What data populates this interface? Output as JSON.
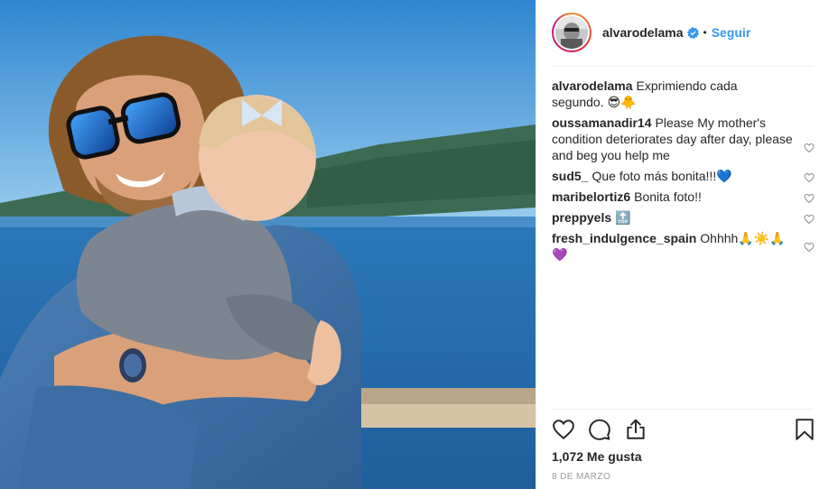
{
  "post": {
    "username": "alvarodelama",
    "follow_separator": "•",
    "follow_label": "Seguir",
    "likes": "1,072 Me gusta",
    "date": "8 DE MARZO"
  },
  "comments": [
    {
      "user": "alvarodelama",
      "text": "Exprimiendo cada segundo. 😎🐥",
      "has_like": false
    },
    {
      "user": "oussamanadir14",
      "text": "Please My mother's condition deteriorates day after day, please and beg you help me",
      "has_like": true
    },
    {
      "user": "sud5_",
      "text": "Que foto más bonita!!!💙",
      "has_like": true
    },
    {
      "user": "maribelortiz6",
      "text": "Bonita foto!!",
      "has_like": true
    },
    {
      "user": "preppyels",
      "text": "🔝",
      "has_like": true
    },
    {
      "user": "fresh_indulgence_spain",
      "text": "Ohhhh🙏☀️🙏💜",
      "has_like": true
    }
  ],
  "icons": {
    "like": "heart-icon",
    "comment": "comment-bubble-icon",
    "share": "share-icon",
    "save": "bookmark-icon",
    "verified": "verified-badge-icon",
    "comment_like": "heart-outline-icon"
  },
  "colors": {
    "link_blue": "#3897f0",
    "text": "#262626",
    "muted": "#999999",
    "divider": "#efefef"
  }
}
